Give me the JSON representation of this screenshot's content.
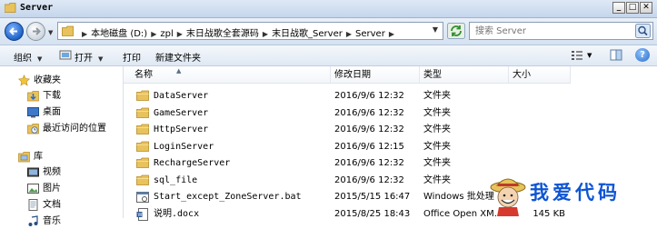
{
  "window": {
    "title": "Server"
  },
  "address": {
    "crumbs": [
      "本地磁盘 (D:)",
      "zpl",
      "末日战歌全套源码",
      "末日战歌_Server",
      "Server"
    ],
    "search_placeholder": "搜索 Server"
  },
  "toolbar": {
    "organize": "组织",
    "open": "打开",
    "print": "打印",
    "new_folder": "新建文件夹"
  },
  "nav": {
    "favorites": "收藏夹",
    "downloads": "下载",
    "desktop": "桌面",
    "recent": "最近访问的位置",
    "libraries": "库",
    "videos": "视频",
    "pictures": "图片",
    "documents": "文档",
    "music": "音乐"
  },
  "columns": {
    "name": "名称",
    "modified": "修改日期",
    "type": "类型",
    "size": "大小"
  },
  "files": [
    {
      "name": "DataServer",
      "modified": "2016/9/6 12:32",
      "type": "文件夹",
      "size": "",
      "icon": "folder-icon"
    },
    {
      "name": "GameServer",
      "modified": "2016/9/6 12:32",
      "type": "文件夹",
      "size": "",
      "icon": "folder-icon"
    },
    {
      "name": "HttpServer",
      "modified": "2016/9/6 12:32",
      "type": "文件夹",
      "size": "",
      "icon": "folder-icon"
    },
    {
      "name": "LoginServer",
      "modified": "2016/9/6 12:15",
      "type": "文件夹",
      "size": "",
      "icon": "folder-icon"
    },
    {
      "name": "RechargeServer",
      "modified": "2016/9/6 12:32",
      "type": "文件夹",
      "size": "",
      "icon": "folder-icon"
    },
    {
      "name": "sql_file",
      "modified": "2016/9/6 12:32",
      "type": "文件夹",
      "size": "",
      "icon": "folder-icon"
    },
    {
      "name": "Start_except_ZoneServer.bat",
      "modified": "2015/5/15 16:47",
      "type": "Windows 批处理 ...",
      "size": "",
      "icon": "batch-file-icon"
    },
    {
      "name": "说明.docx",
      "modified": "2015/8/25 18:43",
      "type": "Office Open XM...",
      "size": "145 KB",
      "icon": "word-document-icon"
    }
  ],
  "watermark": {
    "text": "我爱代码"
  },
  "colors": {
    "title_bar": "#c4d6ec",
    "folder": "#e8c25c",
    "watermark": "#0e55d4"
  }
}
